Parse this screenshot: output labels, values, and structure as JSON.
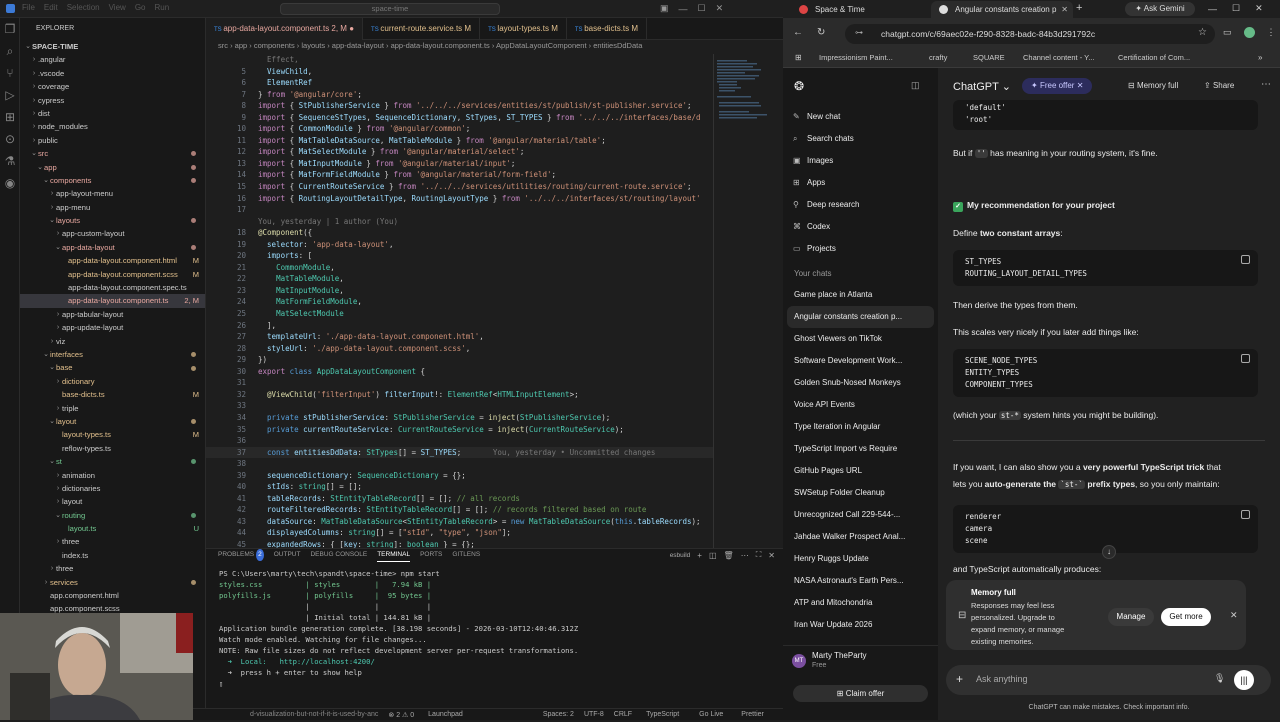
{
  "vscode": {
    "title_menu": [
      "File",
      "Edit",
      "Selection",
      "View",
      "Go",
      "Run"
    ],
    "search_text": "space-time",
    "explorer_title": "EXPLORER",
    "tree": [
      {
        "name": "SPACE-TIME",
        "depth": 0,
        "chev": "⌄",
        "bold": true
      },
      {
        "name": ".angular",
        "depth": 1,
        "chev": "›"
      },
      {
        "name": ".vscode",
        "depth": 1,
        "chev": "›"
      },
      {
        "name": "coverage",
        "depth": 1,
        "chev": "›"
      },
      {
        "name": "cypress",
        "depth": 1,
        "chev": "›"
      },
      {
        "name": "dist",
        "depth": 1,
        "chev": "›"
      },
      {
        "name": "node_modules",
        "depth": 1,
        "chev": "›"
      },
      {
        "name": "public",
        "depth": 1,
        "chev": "›"
      },
      {
        "name": "src",
        "depth": 1,
        "chev": "⌄",
        "color": "#e8a8a0",
        "dot": true
      },
      {
        "name": "app",
        "depth": 2,
        "chev": "⌄",
        "color": "#e8a8a0",
        "dot": true
      },
      {
        "name": "components",
        "depth": 3,
        "chev": "⌄",
        "color": "#e8a8a0",
        "dot": true
      },
      {
        "name": "app-layout-menu",
        "depth": 4,
        "chev": "›"
      },
      {
        "name": "app-menu",
        "depth": 4,
        "chev": "›"
      },
      {
        "name": "layouts",
        "depth": 4,
        "chev": "⌄",
        "color": "#e8a8a0",
        "dot": true
      },
      {
        "name": "app-custom-layout",
        "depth": 5,
        "chev": "›"
      },
      {
        "name": "app-data-layout",
        "depth": 5,
        "chev": "⌄",
        "color": "#e8a8a0",
        "dot": true
      },
      {
        "name": "app-data-layout.component.html",
        "depth": 6,
        "badge": "M",
        "color": "#e2c08d"
      },
      {
        "name": "app-data-layout.component.scss",
        "depth": 6,
        "badge": "M",
        "color": "#e2c08d"
      },
      {
        "name": "app-data-layout.component.spec.ts",
        "depth": 6
      },
      {
        "name": "app-data-layout.component.ts",
        "depth": 6,
        "badge": "2, M",
        "color": "#e8a8a0",
        "sel": true
      },
      {
        "name": "app-tabular-layout",
        "depth": 5,
        "chev": "›"
      },
      {
        "name": "app-update-layout",
        "depth": 5,
        "chev": "›"
      },
      {
        "name": "viz",
        "depth": 4,
        "chev": "›"
      },
      {
        "name": "interfaces",
        "depth": 3,
        "chev": "⌄",
        "color": "#e2c08d",
        "dot": true
      },
      {
        "name": "base",
        "depth": 4,
        "chev": "⌄",
        "color": "#e2c08d",
        "dot": true
      },
      {
        "name": "dictionary",
        "depth": 5,
        "chev": "›",
        "color": "#e2c08d"
      },
      {
        "name": "base-dicts.ts",
        "depth": 5,
        "badge": "M",
        "color": "#e2c08d"
      },
      {
        "name": "triple",
        "depth": 5,
        "chev": "›"
      },
      {
        "name": "layout",
        "depth": 4,
        "chev": "⌄",
        "color": "#e2c08d",
        "dot": true
      },
      {
        "name": "layout-types.ts",
        "depth": 5,
        "badge": "M",
        "color": "#e2c08d"
      },
      {
        "name": "reflow-types.ts",
        "depth": 5
      },
      {
        "name": "st",
        "depth": 4,
        "chev": "⌄",
        "color": "#73c991",
        "dot": true
      },
      {
        "name": "animation",
        "depth": 5,
        "chev": "›"
      },
      {
        "name": "dictionaries",
        "depth": 5,
        "chev": "›"
      },
      {
        "name": "layout",
        "depth": 5,
        "chev": "›"
      },
      {
        "name": "routing",
        "depth": 5,
        "chev": "⌄",
        "color": "#73c991",
        "dot": true
      },
      {
        "name": "layout.ts",
        "depth": 6,
        "badge": "U",
        "color": "#73c991"
      },
      {
        "name": "three",
        "depth": 5,
        "chev": "›"
      },
      {
        "name": "index.ts",
        "depth": 5
      },
      {
        "name": "three",
        "depth": 4,
        "chev": "›"
      },
      {
        "name": "services",
        "depth": 3,
        "chev": "›",
        "color": "#e2c08d",
        "dot": true
      },
      {
        "name": "app.component.html",
        "depth": 3
      },
      {
        "name": "app.component.scss",
        "depth": 3
      }
    ],
    "tabs": [
      {
        "label": "app-data-layout.component.ts 2, M",
        "active": true,
        "dirty": true
      },
      {
        "label": "current-route.service.ts M"
      },
      {
        "label": "layout-types.ts M"
      },
      {
        "label": "base-dicts.ts M"
      }
    ],
    "breadcrumbs": "src › app › components › layouts › app-data-layout › app-data-layout.component.ts › AppDataLayoutComponent › entitiesDdData",
    "code": [
      {
        "n": "",
        "h": "<span class='gh'>  Effect,</span>"
      },
      {
        "n": "5",
        "h": "  <span class='va'>ViewChild</span>,"
      },
      {
        "n": "6",
        "h": "  <span class='va'>ElementRef</span>"
      },
      {
        "n": "7",
        "h": "} <span class='kw'>from</span> <span class='st'>'@angular/core'</span>;"
      },
      {
        "n": "8",
        "h": "<span class='kw'>import</span> { <span class='va'>StPublisherService</span> } <span class='kw'>from</span> <span class='st'>'../../../services/entities/st/publish/st-publisher.service'</span>;"
      },
      {
        "n": "9",
        "h": "<span class='kw'>import</span> { <span class='va'>SequenceStTypes</span>, <span class='va'>SequenceDictionary</span>, <span class='va'>StTypes</span>, <span class='va'>ST_TYPES</span> } <span class='kw'>from</span> <span class='st'>'../../../interfaces/base/d</span>"
      },
      {
        "n": "10",
        "h": "<span class='kw'>import</span> { <span class='va'>CommonModule</span> } <span class='kw'>from</span> <span class='st'>'@angular/common'</span>;"
      },
      {
        "n": "11",
        "h": "<span class='kw'>import</span> { <span class='va'>MatTableDataSource</span>, <span class='va'>MatTableModule</span> } <span class='kw'>from</span> <span class='st'>'@angular/material/table'</span>;"
      },
      {
        "n": "12",
        "h": "<span class='kw'>import</span> { <span class='va'>MatSelectModule</span> } <span class='kw'>from</span> <span class='st'>'@angular/material/select'</span>;"
      },
      {
        "n": "13",
        "h": "<span class='kw'>import</span> { <span class='va'>MatInputModule</span> } <span class='kw'>from</span> <span class='st'>'@angular/material/input'</span>;"
      },
      {
        "n": "14",
        "h": "<span class='kw'>import</span> { <span class='va'>MatFormFieldModule</span> } <span class='kw'>from</span> <span class='st'>'@angular/material/form-field'</span>;"
      },
      {
        "n": "15",
        "h": "<span class='kw'>import</span> { <span class='va'>CurrentRouteService</span> } <span class='kw'>from</span> <span class='st'>'../../../services/utilities/routing/current-route.service'</span>;"
      },
      {
        "n": "16",
        "h": "<span class='kw'>import</span> { <span class='va'>RoutingLayoutDetailType</span>, <span class='va'>RoutingLayoutType</span> } <span class='kw'>from</span> <span class='st'>'../../../interfaces/st/routing/layout'</span>"
      },
      {
        "n": "17",
        "h": ""
      },
      {
        "n": "",
        "h": "<span class='gh'>You, yesterday | 1 author (You)</span>"
      },
      {
        "n": "18",
        "h": "<span class='fn'>@Component</span>({"
      },
      {
        "n": "19",
        "h": "  <span class='va'>selector</span>: <span class='st'>'app-data-layout'</span>,"
      },
      {
        "n": "20",
        "h": "  <span class='va'>imports</span>: ["
      },
      {
        "n": "21",
        "h": "    <span class='ty'>CommonModule</span>,"
      },
      {
        "n": "22",
        "h": "    <span class='ty'>MatTableModule</span>,"
      },
      {
        "n": "23",
        "h": "    <span class='ty'>MatInputModule</span>,"
      },
      {
        "n": "24",
        "h": "    <span class='ty'>MatFormFieldModule</span>,"
      },
      {
        "n": "25",
        "h": "    <span class='ty'>MatSelectModule</span>"
      },
      {
        "n": "26",
        "h": "  ],"
      },
      {
        "n": "27",
        "h": "  <span class='va'>templateUrl</span>: <span class='st'>'./app-data-layout.component.html'</span>,"
      },
      {
        "n": "28",
        "h": "  <span class='va'>styleUrl</span>: <span class='st'>'./app-data-layout.component.scss'</span>,"
      },
      {
        "n": "29",
        "h": "})"
      },
      {
        "n": "30",
        "h": "<span class='kw'>export</span> <span class='bl'>class</span> <span class='ty'>AppDataLayoutComponent</span> {"
      },
      {
        "n": "31",
        "h": ""
      },
      {
        "n": "32",
        "h": "  <span class='fn'>@ViewChild</span>(<span class='st'>'filterInput'</span>) <span class='va'>filterInput</span>!: <span class='ty'>ElementRef</span>&lt;<span class='ty'>HTMLInputElement</span>&gt;;"
      },
      {
        "n": "33",
        "h": ""
      },
      {
        "n": "34",
        "h": "  <span class='bl'>private</span> <span class='va'>stPublisherService</span>: <span class='ty'>StPublisherService</span> = <span class='fn'>inject</span>(<span class='ty'>StPublisherService</span>);"
      },
      {
        "n": "35",
        "h": "  <span class='bl'>private</span> <span class='va'>currentRouteService</span>: <span class='ty'>CurrentRouteService</span> = <span class='fn'>inject</span>(<span class='ty'>CurrentRouteService</span>);"
      },
      {
        "n": "36",
        "h": ""
      },
      {
        "n": "37",
        "h": "  <span class='bl'>const</span> <span class='va'>entitiesDdData</span>: <span class='ty'>StTypes</span>[] = <span class='va'>ST_TYPES</span>;       <span class='gh'>You, yesterday • Uncommitted changes</span>"
      },
      {
        "n": "38",
        "h": ""
      },
      {
        "n": "39",
        "h": "  <span class='va'>sequenceDictionary</span>: <span class='ty'>SequenceDictionary</span> = {};"
      },
      {
        "n": "40",
        "h": "  <span class='va'>stIds</span>: <span class='ty'>string</span>[] = [];"
      },
      {
        "n": "41",
        "h": "  <span class='va'>tableRecords</span>: <span class='ty'>StEntityTableRecord</span>[] = []; <span class='cm'>// all records</span>"
      },
      {
        "n": "42",
        "h": "  <span class='va'>routeFilteredRecords</span>: <span class='ty'>StEntityTableRecord</span>[] = []; <span class='cm'>// records filtered based on route</span>"
      },
      {
        "n": "43",
        "h": "  <span class='va'>dataSource</span>: <span class='ty'>MatTableDataSource</span>&lt;<span class='ty'>StEntityTableRecord</span>&gt; = <span class='bl'>new</span> <span class='ty'>MatTableDataSource</span>(<span class='bl'>this</span>.<span class='va'>tableRecords</span>);"
      },
      {
        "n": "44",
        "h": "  <span class='va'>displayedColumns</span>: <span class='ty'>string</span>[] = [<span class='st'>\"stId\"</span>, <span class='st'>\"type\"</span>, <span class='st'>\"json\"</span>];"
      },
      {
        "n": "45",
        "h": "  <span class='va'>expandedRows</span>: { [<span class='va'>key</span>: <span class='ty'>string</span>]: <span class='ty'>boolean</span> } = {};"
      }
    ],
    "panel_tabs": [
      "PROBLEMS",
      "OUTPUT",
      "DEBUG CONSOLE",
      "TERMINAL",
      "PORTS",
      "GITLENS"
    ],
    "problems_count": "2",
    "terminal_shell": "esbuild",
    "terminal": [
      "PS C:\\Users\\marty\\tech\\spandt\\space-time> npm start",
      "styles.css          | styles        |   7.94 kB |",
      "polyfills.js        | polyfills     |  95 bytes |",
      "                    |               |           |",
      "                    | Initial total | 144.81 kB |",
      "",
      "Application bundle generation complete. [38.198 seconds] - 2026-03-10T12:40:46.312Z",
      "",
      "Watch mode enabled. Watching for file changes...",
      "NOTE: Raw file sizes do not reflect development server per-request transformations.",
      "  ➜  Local:   http://localhost:4200/",
      "  ➜  press h + enter to show help",
      "▯"
    ],
    "status": {
      "left": "d-visualization-but-not-if-it-is-used-by-anc",
      "errors": "⊗ 2 ⚠ 0",
      "launchpad": "Launchpad",
      "spaces": "Spaces: 2",
      "encoding": "UTF-8",
      "eol": "CRLF",
      "lang": "TypeScript",
      "golive": "Go Live",
      "prettier": "Prettier"
    }
  },
  "browser": {
    "tabs": [
      {
        "label": "Space & Time"
      },
      {
        "label": "Angular constants creation p",
        "active": true
      }
    ],
    "gemini": "Ask Gemini",
    "url": "chatgpt.com/c/69aec02e-f290-8328-badc-84b3d291792c",
    "bookmarks": [
      "Impressionism Paint...",
      "crafty",
      "SQUARE",
      "Channel content - Y...",
      "Certification of Com..."
    ],
    "gpt": {
      "brand": "ChatGPT",
      "offer": "Free offer",
      "memory": "Memory full",
      "share": "Share",
      "nav": [
        "New chat",
        "Search chats",
        "Images",
        "Apps",
        "Deep research",
        "Codex",
        "Projects"
      ],
      "your_chats": "Your chats",
      "chats": [
        "Game place in Atlanta",
        "Angular constants creation p...",
        "Ghost Viewers on TikTok",
        "Software Development Work...",
        "Golden Snub-Nosed Monkeys",
        "Voice API Events",
        "Type Iteration in Angular",
        "TypeScript Import vs Require",
        "GitHub Pages URL",
        "SWSetup Folder Cleanup",
        "Unrecognized Call 229-544-...",
        "Jahdae Walker Prospect Anal...",
        "Henry Ruggs Update",
        "NASA Astronaut's Earth Pers...",
        "ATP and Mitochondria",
        "Iran War Update 2026"
      ],
      "user": "Marty TheParty",
      "plan": "Free",
      "initials": "MT",
      "claim": "Claim offer",
      "msg": {
        "code0": [
          "'default'",
          "'root'"
        ],
        "t1a": "But if",
        "t1c": "''",
        "t1b": "has meaning in your routing system, it's fine.",
        "rec": "My recommendation for your project",
        "define": "Define",
        "define_b": "two constant arrays",
        "define_c": ":",
        "code1": [
          "ST_TYPES",
          "ROUTING_LAYOUT_DETAIL_TYPES"
        ],
        "derive": "Then derive the types from them.",
        "scales": "This scales very nicely if you later add things like:",
        "code2": [
          "SCENE_NODE_TYPES",
          "ENTITY_TYPES",
          "COMPONENT_TYPES"
        ],
        "which_a": "(which your",
        "which_c": "st-*",
        "which_b": "system hints you might be building).",
        "want_a": "If you want, I can also show you a",
        "want_b": "very powerful TypeScript trick",
        "want_c": "that",
        "lets_a": "lets you",
        "lets_b": "auto-generate the",
        "lets_c": "`st-`",
        "lets_d": "prefix types",
        "lets_e": ", so you only maintain:",
        "code3": [
          "renderer",
          "camera",
          "scene"
        ],
        "produces": "and TypeScript automatically produces:"
      },
      "toast": {
        "title": "Memory full",
        "body": [
          "Responses may feel less",
          "personalized. Upgrade to",
          "expand memory, or manage",
          "existing memories."
        ],
        "manage": "Manage",
        "get_more": "Get more"
      },
      "input_placeholder": "Ask anything",
      "disclaimer": "ChatGPT can make mistakes. Check important info."
    }
  },
  "colors": {
    "accent": "#3b82f6",
    "offer": "#2a2a5a",
    "git_modified": "#e2c08d",
    "git_error": "#e8a8a0",
    "git_untracked": "#73c991"
  }
}
